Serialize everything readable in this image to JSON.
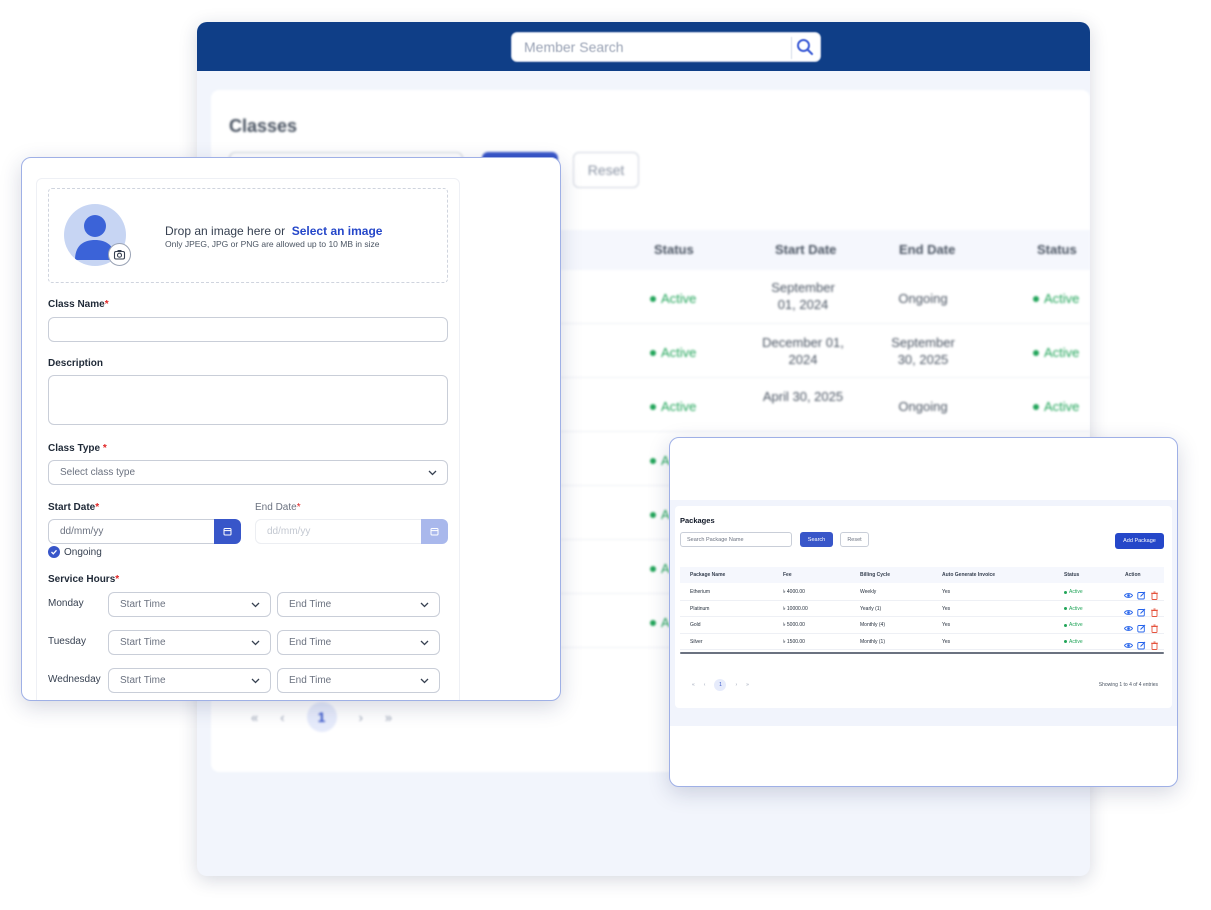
{
  "back": {
    "search_placeholder": "Member Search",
    "title": "Classes",
    "reset_label": "Reset",
    "columns": [
      "Status",
      "Start Date",
      "End Date",
      "Status"
    ],
    "rows": [
      {
        "status": "Active",
        "start_date": "September 01, 2024",
        "end_date": "Ongoing",
        "status2": "Active"
      },
      {
        "status": "Active",
        "start_date": "December 01, 2024",
        "end_date": "September 30, 2025",
        "status2": "Active"
      },
      {
        "status": "Active",
        "start_date": "April 30, 2025",
        "end_date": "Ongoing",
        "status2": "Active"
      }
    ],
    "partial_active": [
      "A",
      "A",
      "A",
      "A"
    ],
    "pager": {
      "first": "«",
      "prev": "‹",
      "current": "1",
      "next": "›",
      "last": "»"
    }
  },
  "form": {
    "drop_text": "Drop an image here or",
    "drop_link": "Select an image",
    "drop_sub": "Only JPEG, JPG or PNG are allowed up to 10 MB in size",
    "class_name_label": "Class Name",
    "description_label": "Description",
    "class_type_label": "Class Type ",
    "class_type_placeholder": "Select class type",
    "start_date_label": "Start Date",
    "end_date_label": "End Date",
    "date_placeholder": "dd/mm/yy",
    "ongoing_label": "Ongoing",
    "service_hours_label": "Service Hours",
    "required_mark": "*",
    "start_time_placeholder": "Start Time",
    "end_time_placeholder": "End Time",
    "days": [
      "Monday",
      "Tuesday",
      "Wednesday"
    ]
  },
  "packages": {
    "title": "Packages",
    "search_placeholder": "Search Package Name",
    "search_label": "Search",
    "reset_label": "Reset",
    "add_label": "Add Package",
    "columns": [
      "Package Name",
      "Fee",
      "Billing Cycle",
      "Auto Generate Invoice",
      "Status",
      "Action"
    ],
    "rows": [
      {
        "name": "Etherium",
        "fee": "৳ 4000.00",
        "cycle": "Weekly",
        "auto": "Yes",
        "status": "Active"
      },
      {
        "name": "Platinum",
        "fee": "৳ 10000.00",
        "cycle": "Yearly (1)",
        "auto": "Yes",
        "status": "Active"
      },
      {
        "name": "Gold",
        "fee": "৳ 5000.00",
        "cycle": "Monthly (4)",
        "auto": "Yes",
        "status": "Active"
      },
      {
        "name": "Silver",
        "fee": "৳ 1500.00",
        "cycle": "Monthly (1)",
        "auto": "Yes",
        "status": "Active"
      }
    ],
    "pager": {
      "first": "«",
      "prev": "‹",
      "current": "1",
      "next": "›",
      "last": "»"
    },
    "entries_text": "Showing 1 to 4 of 4 entries"
  },
  "colors": {
    "header_navy": "#0f3e87",
    "primary": "#3856c9",
    "active_green": "#22a55a",
    "required_red": "#e02424"
  }
}
